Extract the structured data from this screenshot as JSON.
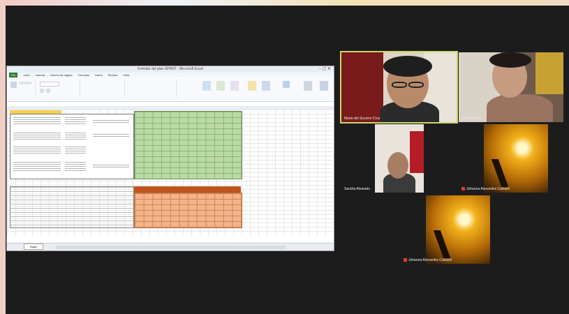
{
  "excel": {
    "title": "Formato del plan SPRNT - Microsoft Excel",
    "window_controls": "– ▢ ✕",
    "tabs": [
      "File",
      "Inicio",
      "Insertar",
      "Diseño de página",
      "Fórmulas",
      "Datos",
      "Revisar",
      "Vista"
    ],
    "sheet_tab": "Hoja1"
  },
  "participants": [
    {
      "name": "Maria del Socorro Cruz",
      "muted": false,
      "active": true
    },
    {
      "name": "Emily Osorio",
      "muted": false,
      "active": false
    },
    {
      "name": "Sandra Alvarado",
      "muted": false,
      "active": false
    },
    {
      "name": "Johanna Alexandra Calvach",
      "muted": true,
      "active": false
    },
    {
      "name": "Johanna Alexandra Calvach",
      "muted": true,
      "active": false
    }
  ],
  "colors": {
    "active_speaker": "#c9d86a",
    "meeting_bg": "#1c1c1c",
    "muted": "#e53935"
  }
}
